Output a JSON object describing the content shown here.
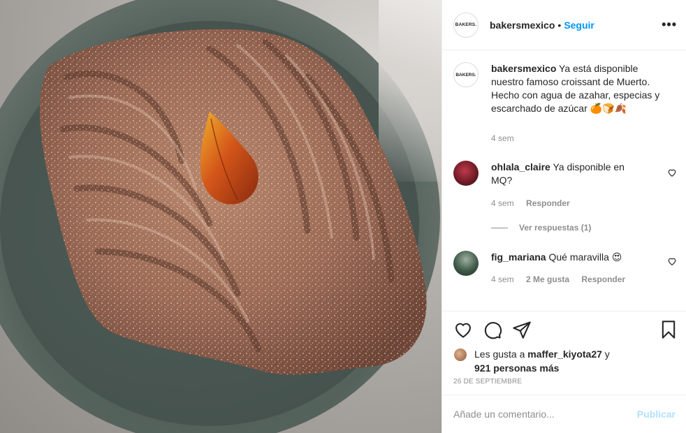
{
  "post": {
    "author": "bakersmexico",
    "avatar_logo_text": "BAKERS.",
    "follow_label": "Seguir",
    "separator": "•",
    "more_label": "•••"
  },
  "caption": {
    "author": "bakersmexico",
    "text": "Ya está disponible nuestro famoso croissant de Muerto. Hecho con agua de azahar, especias y escarchado de azúcar 🍊🍞🍂",
    "time": "4 sem"
  },
  "comments": [
    {
      "author": "ohlala_claire",
      "text": "Ya disponible en MQ?",
      "time": "4 sem",
      "reply_label": "Responder",
      "view_replies": "Ver respuestas (1)"
    },
    {
      "author": "fig_mariana",
      "text": "Qué maravilla 😍",
      "time": "4 sem",
      "likes": "2 Me gusta",
      "reply_label": "Responder"
    }
  ],
  "likes": {
    "prefix": "Les gusta a ",
    "user": "maffer_kiyota27",
    "connector": " y",
    "others": "921 personas más"
  },
  "date": "26 DE SEPTIEMBRE",
  "add_comment": {
    "placeholder": "Añade un comentario...",
    "publish_label": "Publicar"
  },
  "colors": {
    "accent": "#0095f6",
    "publish_disabled": "#b2dffc",
    "muted_text": "#8e8e8e"
  }
}
